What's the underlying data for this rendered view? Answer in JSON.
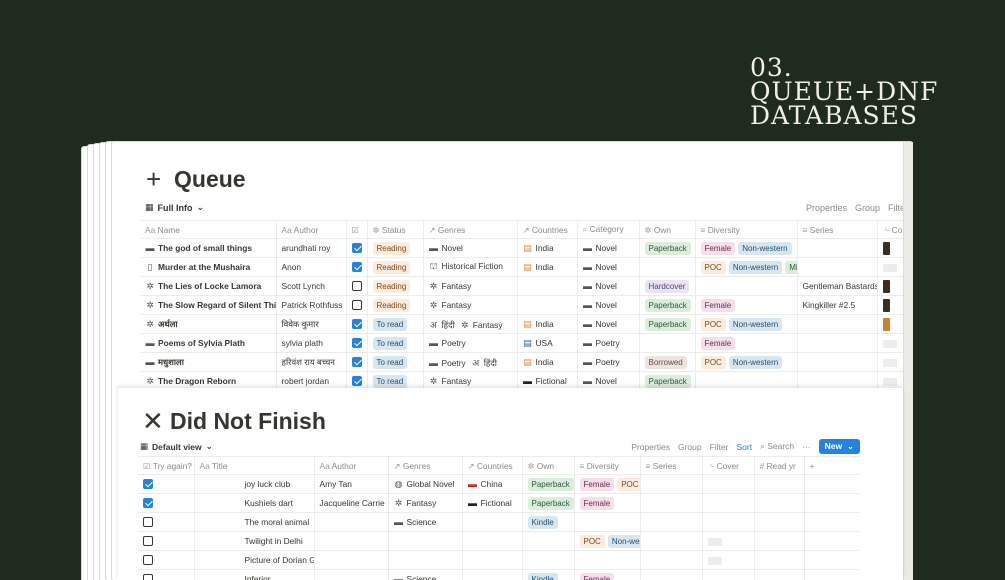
{
  "deco": {
    "line1": "03.",
    "line2": "QUEUE+DNF",
    "line3": "DATABASES"
  },
  "queue": {
    "icon": "plus-icon",
    "title": "Queue",
    "view_name": "Full Info",
    "toolbar": {
      "properties": "Properties",
      "group": "Group",
      "filter": "Filte"
    },
    "columns": [
      "Name",
      "Author",
      "",
      "Status",
      "Genres",
      "Countries",
      "Category",
      "Own",
      "Diversity",
      "Series",
      "Co"
    ],
    "rows": [
      {
        "icon": "folder-icon",
        "name": "The god of small things",
        "author": "arundhati roy",
        "checked": true,
        "status": "Reading",
        "genres": [
          {
            "icon": "folder-icon",
            "text": "Novel"
          }
        ],
        "country": "India",
        "country_icon": "india-flag-icon",
        "category": "Novel",
        "own": "Paperback",
        "diversity": [
          "Female",
          "Non-western"
        ],
        "series": "",
        "cover": "dark"
      },
      {
        "icon": "book-icon",
        "name": "Murder at the Mushaira",
        "author": "Anon",
        "checked": true,
        "status": "Reading",
        "genres": [
          {
            "icon": "temple-icon",
            "text": "Historical Fiction"
          }
        ],
        "country": "India",
        "country_icon": "india-flag-icon",
        "category": "Novel",
        "own": "",
        "diversity": [
          "POC",
          "Non-western",
          "Mi"
        ],
        "series": "",
        "cover": "grey"
      },
      {
        "icon": "sparkle-icon",
        "name": "The Lies of Locke Lamora",
        "author": "Scott Lynch",
        "checked": false,
        "status": "Reading",
        "genres": [
          {
            "icon": "sparkle-icon",
            "text": "Fantasy"
          }
        ],
        "country": "",
        "country_icon": "",
        "category": "Novel",
        "own": "Hardcover",
        "diversity": [],
        "series": "Gentleman Bastards",
        "cover": "dark"
      },
      {
        "icon": "sparkle-icon",
        "name": "The Slow Regard of Silent Thin",
        "author": "Patrick Rothfuss",
        "checked": false,
        "status": "Reading",
        "genres": [
          {
            "icon": "sparkle-icon",
            "text": "Fantasy"
          }
        ],
        "country": "",
        "country_icon": "",
        "category": "Novel",
        "own": "Paperback",
        "diversity": [
          "Female"
        ],
        "series": "Kingkiller #2.5",
        "cover": "dark"
      },
      {
        "icon": "sparkle-icon",
        "name": "अर्थला",
        "author": "विवेक कुमार",
        "checked": true,
        "status": "To read",
        "genres": [
          {
            "icon": "hindi-icon",
            "text": "हिंदी"
          },
          {
            "icon": "sparkle-icon",
            "text": "Fantasy"
          }
        ],
        "country": "India",
        "country_icon": "india-flag-icon",
        "category": "Novel",
        "own": "Paperback",
        "diversity": [
          "POC",
          "Non-western"
        ],
        "series": "",
        "cover": "orange"
      },
      {
        "icon": "folder-icon",
        "name": "Poems of Sylvia Plath",
        "author": "sylvia plath",
        "checked": true,
        "status": "To read",
        "genres": [
          {
            "icon": "folder-icon",
            "text": "Poetry"
          }
        ],
        "country": "USA",
        "country_icon": "usa-flag-icon",
        "category": "Poetry",
        "own": "",
        "diversity": [
          "Female"
        ],
        "series": "",
        "cover": "grey"
      },
      {
        "icon": "folder-icon",
        "name": "मधुशाला",
        "author": "हरिवंश राय बच्चन",
        "checked": true,
        "status": "To read",
        "genres": [
          {
            "icon": "folder-icon",
            "text": "Poetry"
          },
          {
            "icon": "hindi-icon",
            "text": "हिंदी"
          }
        ],
        "country": "India",
        "country_icon": "india-flag-icon",
        "category": "Poetry",
        "own": "Borrowed",
        "diversity": [
          "POC",
          "Non-western"
        ],
        "series": "",
        "cover": "grey"
      },
      {
        "icon": "sparkle-icon",
        "name": "The Dragon Reborn",
        "author": "robert jordan",
        "checked": true,
        "status": "To read",
        "genres": [
          {
            "icon": "sparkle-icon",
            "text": "Fantasy"
          }
        ],
        "country": "Fictional",
        "country_icon": "black-flag-icon",
        "category": "Novel",
        "own": "Paperback",
        "diversity": [],
        "series": "",
        "cover": "grey"
      }
    ]
  },
  "dnf": {
    "icon": "close-icon",
    "title": "Did Not Finish",
    "view_name": "Default view",
    "toolbar": {
      "properties": "Properties",
      "group": "Group",
      "filter": "Filter",
      "sort": "Sort",
      "search": "Search",
      "more": "···",
      "new": "New"
    },
    "columns": [
      "Try again?",
      "Title",
      "Author",
      "Genres",
      "Countries",
      "Own",
      "Diversity",
      "Series",
      "Cover",
      "Read yr",
      "+"
    ],
    "rows": [
      {
        "checked": true,
        "title": "joy luck club",
        "author": "Amy Tan",
        "genres": [
          {
            "icon": "globe-icon",
            "text": "Global Novel"
          }
        ],
        "country": "China",
        "country_icon": "china-flag-icon",
        "own": "Paperback",
        "diversity": [
          "Female",
          "POC"
        ],
        "cover": ""
      },
      {
        "checked": true,
        "title": "Kushiels dart",
        "author": "Jacqueline Carrie",
        "genres": [
          {
            "icon": "sparkle-icon",
            "text": "Fantasy"
          }
        ],
        "country": "Fictional",
        "country_icon": "black-flag-icon",
        "own": "Paperback",
        "diversity": [
          "Female"
        ],
        "cover": ""
      },
      {
        "checked": false,
        "title": "The moral animal",
        "author": "",
        "genres": [
          {
            "icon": "folder-icon",
            "text": "Science"
          }
        ],
        "country": "",
        "country_icon": "",
        "own": "Kindle",
        "diversity": [],
        "cover": ""
      },
      {
        "checked": false,
        "title": "Twilight in Delhi",
        "author": "",
        "genres": [],
        "country": "",
        "country_icon": "",
        "own": "",
        "diversity": [
          "POC",
          "Non-wes"
        ],
        "cover": "grey"
      },
      {
        "checked": false,
        "title": "Picture of Dorian Gray",
        "author": "",
        "genres": [],
        "country": "",
        "country_icon": "",
        "own": "",
        "diversity": [],
        "cover": "grey"
      },
      {
        "checked": false,
        "title": "Inferior",
        "author": "",
        "genres": [
          {
            "icon": "folder-icon",
            "text": "Science"
          }
        ],
        "country": "",
        "country_icon": "",
        "own": "Kindle",
        "diversity": [
          "Female"
        ],
        "cover": ""
      }
    ]
  }
}
